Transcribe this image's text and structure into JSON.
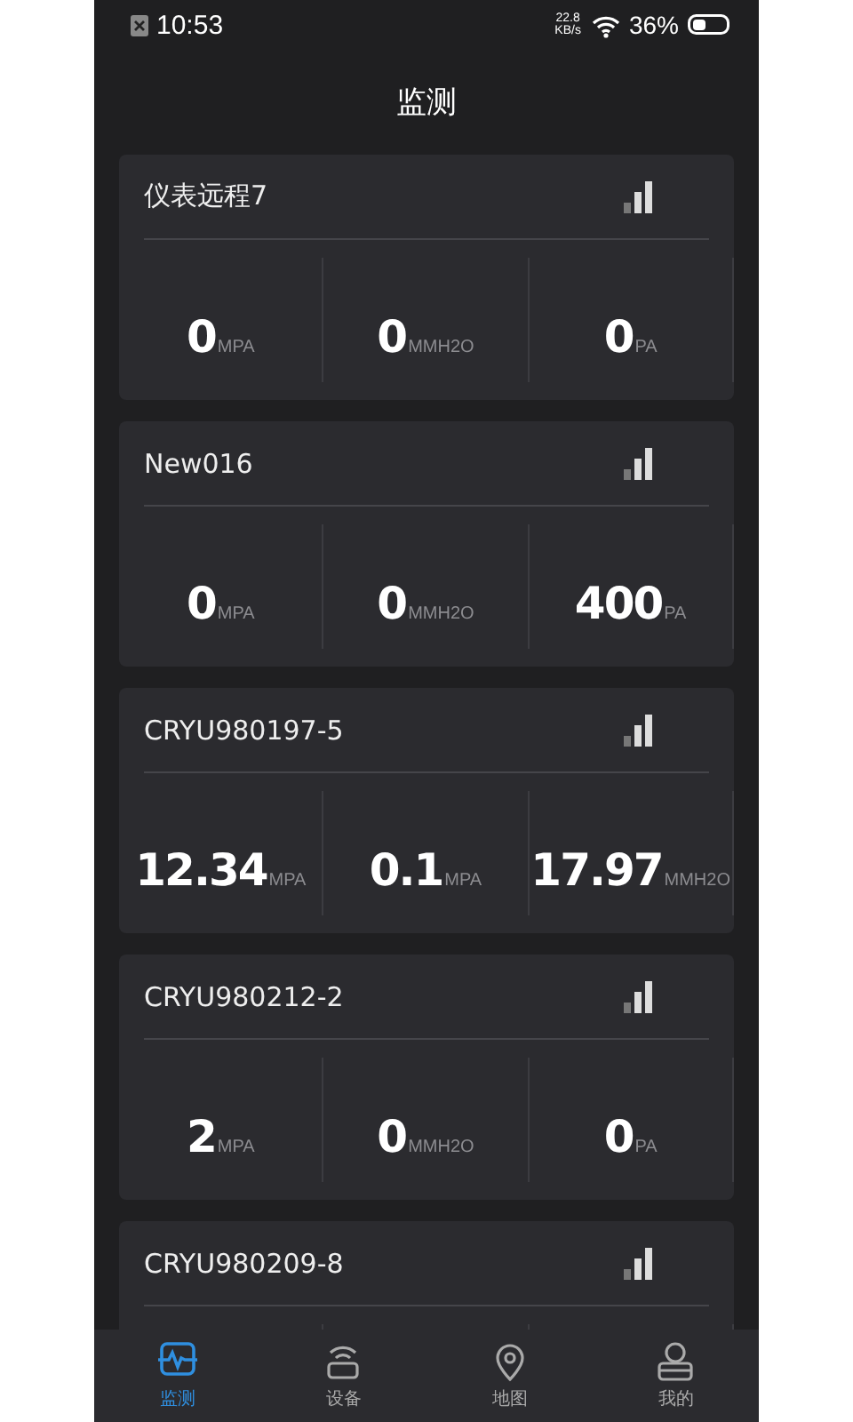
{
  "status_bar": {
    "time": "10:53",
    "net_speed": "22.8",
    "net_unit": "KB/s",
    "battery": "36%"
  },
  "title": "监测",
  "devices": [
    {
      "name": "仪表远程7",
      "readings": [
        {
          "value": "0",
          "unit": "MPA"
        },
        {
          "value": "0",
          "unit": "MMH2O"
        },
        {
          "value": "0",
          "unit": "PA"
        }
      ]
    },
    {
      "name": "New016",
      "readings": [
        {
          "value": "0",
          "unit": "MPA"
        },
        {
          "value": "0",
          "unit": "MMH2O"
        },
        {
          "value": "400",
          "unit": "PA"
        }
      ]
    },
    {
      "name": "CRYU980197-5",
      "readings": [
        {
          "value": "12.34",
          "unit": "MPA"
        },
        {
          "value": "0.1",
          "unit": "MPA"
        },
        {
          "value": "17.97",
          "unit": "MMH2O"
        }
      ]
    },
    {
      "name": "CRYU980212-2",
      "readings": [
        {
          "value": "2",
          "unit": "MPA"
        },
        {
          "value": "0",
          "unit": "MMH2O"
        },
        {
          "value": "0",
          "unit": "PA"
        }
      ]
    },
    {
      "name": "CRYU980209-8"
    }
  ],
  "tabs": [
    {
      "kind": "monitor",
      "label": "监测",
      "selected": true
    },
    {
      "kind": "device",
      "label": "设备",
      "selected": false
    },
    {
      "kind": "map",
      "label": "地图",
      "selected": false
    },
    {
      "kind": "profile",
      "label": "我的",
      "selected": false
    }
  ]
}
